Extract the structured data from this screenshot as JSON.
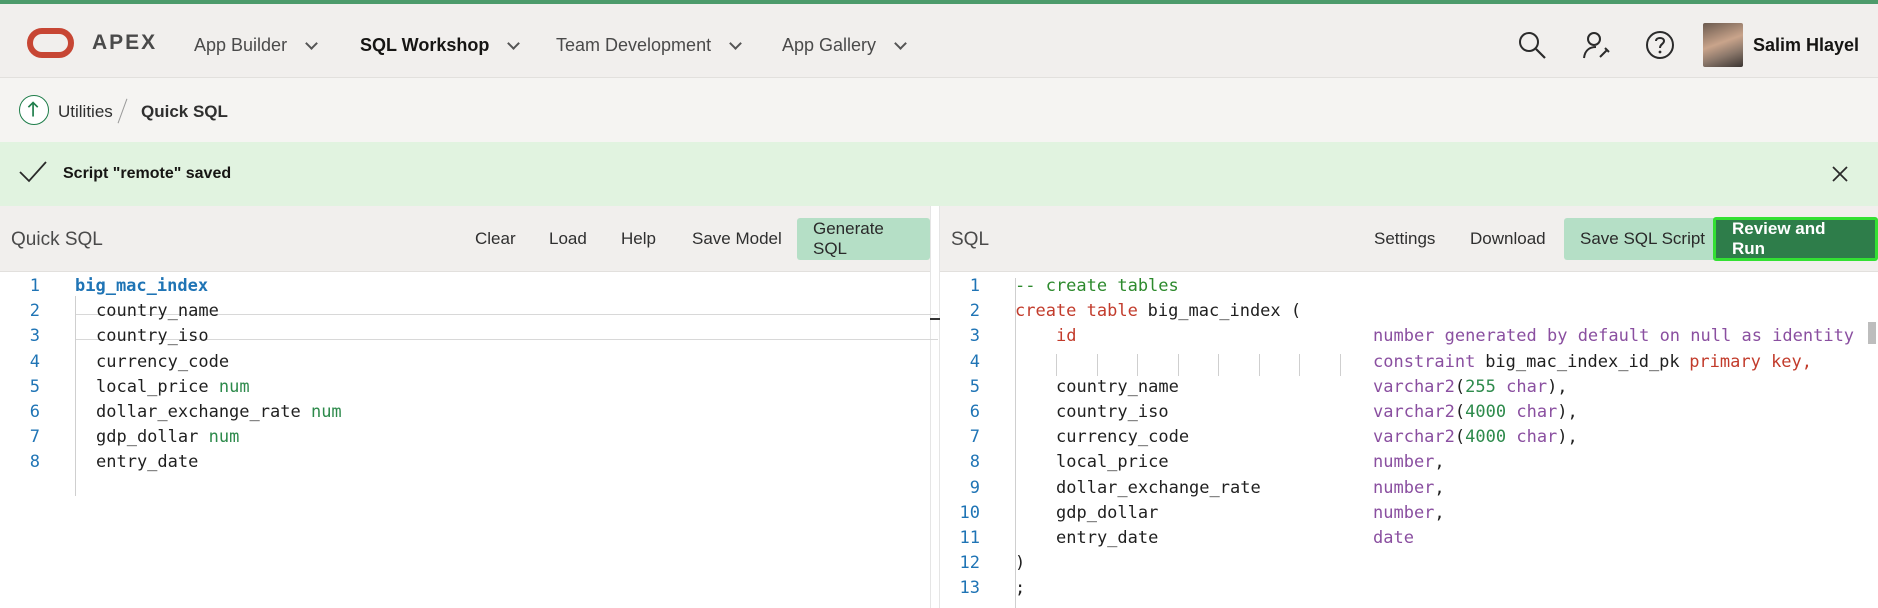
{
  "topnav": {
    "brand": "APEX",
    "items": [
      {
        "label": "App Builder",
        "active": false
      },
      {
        "label": "SQL Workshop",
        "active": true
      },
      {
        "label": "Team Development",
        "active": false
      },
      {
        "label": "App Gallery",
        "active": false
      }
    ],
    "user": "Salim Hlayel"
  },
  "breadcrumb": {
    "parent": "Utilities",
    "current": "Quick SQL"
  },
  "alert": {
    "message": "Script \"remote\" saved"
  },
  "left_panel": {
    "title": "Quick SQL",
    "buttons": {
      "clear": "Clear",
      "load": "Load",
      "help": "Help",
      "save_model": "Save Model",
      "generate": "Generate SQL"
    },
    "lines": [
      {
        "n": "1",
        "text": "big_mac_index",
        "type": ""
      },
      {
        "n": "2",
        "text": "country_name",
        "type": ""
      },
      {
        "n": "3",
        "text": "country_iso",
        "type": ""
      },
      {
        "n": "4",
        "text": "currency_code",
        "type": ""
      },
      {
        "n": "5",
        "text": "local_price",
        "type": "num"
      },
      {
        "n": "6",
        "text": "dollar_exchange_rate",
        "type": "num"
      },
      {
        "n": "7",
        "text": "gdp_dollar",
        "type": "num"
      },
      {
        "n": "8",
        "text": "entry_date",
        "type": ""
      }
    ]
  },
  "right_panel": {
    "title": "SQL",
    "buttons": {
      "settings": "Settings",
      "download": "Download",
      "save_script": "Save SQL Script",
      "review_run": "Review and Run"
    },
    "line_numbers": [
      "1",
      "2",
      "3",
      "4",
      "5",
      "6",
      "7",
      "8",
      "9",
      "10",
      "11",
      "12",
      "13"
    ],
    "sql": {
      "l1": "-- create tables",
      "l2_kw": "create table",
      "l2_name": "big_mac_index (",
      "l3_col": "id",
      "l3_rest": "number generated by default on null as identity",
      "l4_kw": "constraint",
      "l4_name": "big_mac_index_id_pk",
      "l4_pk": "primary key,",
      "cols": [
        {
          "name": "country_name",
          "type": "varchar2",
          "args": "(255 char),"
        },
        {
          "name": "country_iso",
          "type": "varchar2",
          "args": "(4000 char),"
        },
        {
          "name": "currency_code",
          "type": "varchar2",
          "args": "(4000 char),"
        },
        {
          "name": "local_price",
          "type": "number",
          "args": ","
        },
        {
          "name": "dollar_exchange_rate",
          "type": "number",
          "args": ","
        },
        {
          "name": "gdp_dollar",
          "type": "number",
          "args": ","
        },
        {
          "name": "entry_date",
          "type": "date",
          "args": ""
        }
      ],
      "l12": ")",
      "l13": ";"
    }
  },
  "colors": {
    "brand_red": "#c74634",
    "accent_green": "#2e7d4a",
    "success_bg": "#e1f3e0"
  }
}
